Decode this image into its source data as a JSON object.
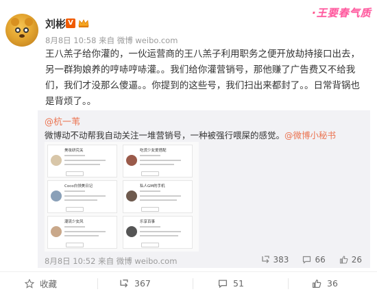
{
  "post": {
    "author": "刘彬",
    "verified_badge": "V",
    "meta": "8月8日 10:58 来自 微博 weibo.com",
    "text": "王八羔子给你灌的，一伙运营商的王八羔子利用职务之便开放劫持接口出去，另一群狗娘养的哼哧哼哧灌。。我们给你灌营销号，那他赚了广告费又不给我们，我们才没那么傻逼。。你提到的这些号，我们扫出来都封了。。日常背锅也是背烦了。。"
  },
  "brand_logo": {
    "text": "王要春气质",
    "prefix": "·"
  },
  "repost": {
    "author": "@杭一苇",
    "text": "微博动不动帮我自动关注一堆营销号，一种被强行喂屎的感觉。",
    "tag": "@微博小秘书",
    "meta": "8月8日 10:52 来自 微博 weibo.com",
    "stats": {
      "reposts": "383",
      "comments": "66",
      "likes": "26"
    },
    "image_cards": [
      "美妆研究关",
      "吃货少女爱搭配",
      "Coco白领美日记",
      "私人GM的手机",
      "潮流少女风",
      "乐享百事"
    ]
  },
  "actions": {
    "favorite": "收藏",
    "repost": "367",
    "comment": "51",
    "like": "36"
  },
  "colors": {
    "accent": "#eb7350",
    "verified": "#f05a00",
    "logo": "#ff5a9e",
    "repost_bg": "#f2f2f5"
  }
}
